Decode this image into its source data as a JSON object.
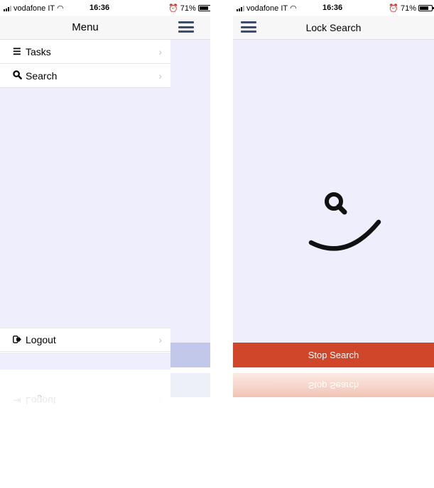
{
  "status_bar": {
    "carrier": "vodafone IT",
    "time": "16:36",
    "battery": "71%"
  },
  "left": {
    "menu_title": "Menu",
    "items": [
      {
        "label": "Tasks",
        "icon": "list-icon"
      },
      {
        "label": "Search",
        "icon": "search-icon"
      }
    ],
    "logout": {
      "label": "Logout",
      "icon": "sign-out-icon"
    }
  },
  "right": {
    "title": "Lock Search",
    "stop_button": "Stop Search"
  },
  "colors": {
    "accent": "#d0462b",
    "content_bg": "#eeeefc",
    "nav_icon": "#3c4b72"
  }
}
